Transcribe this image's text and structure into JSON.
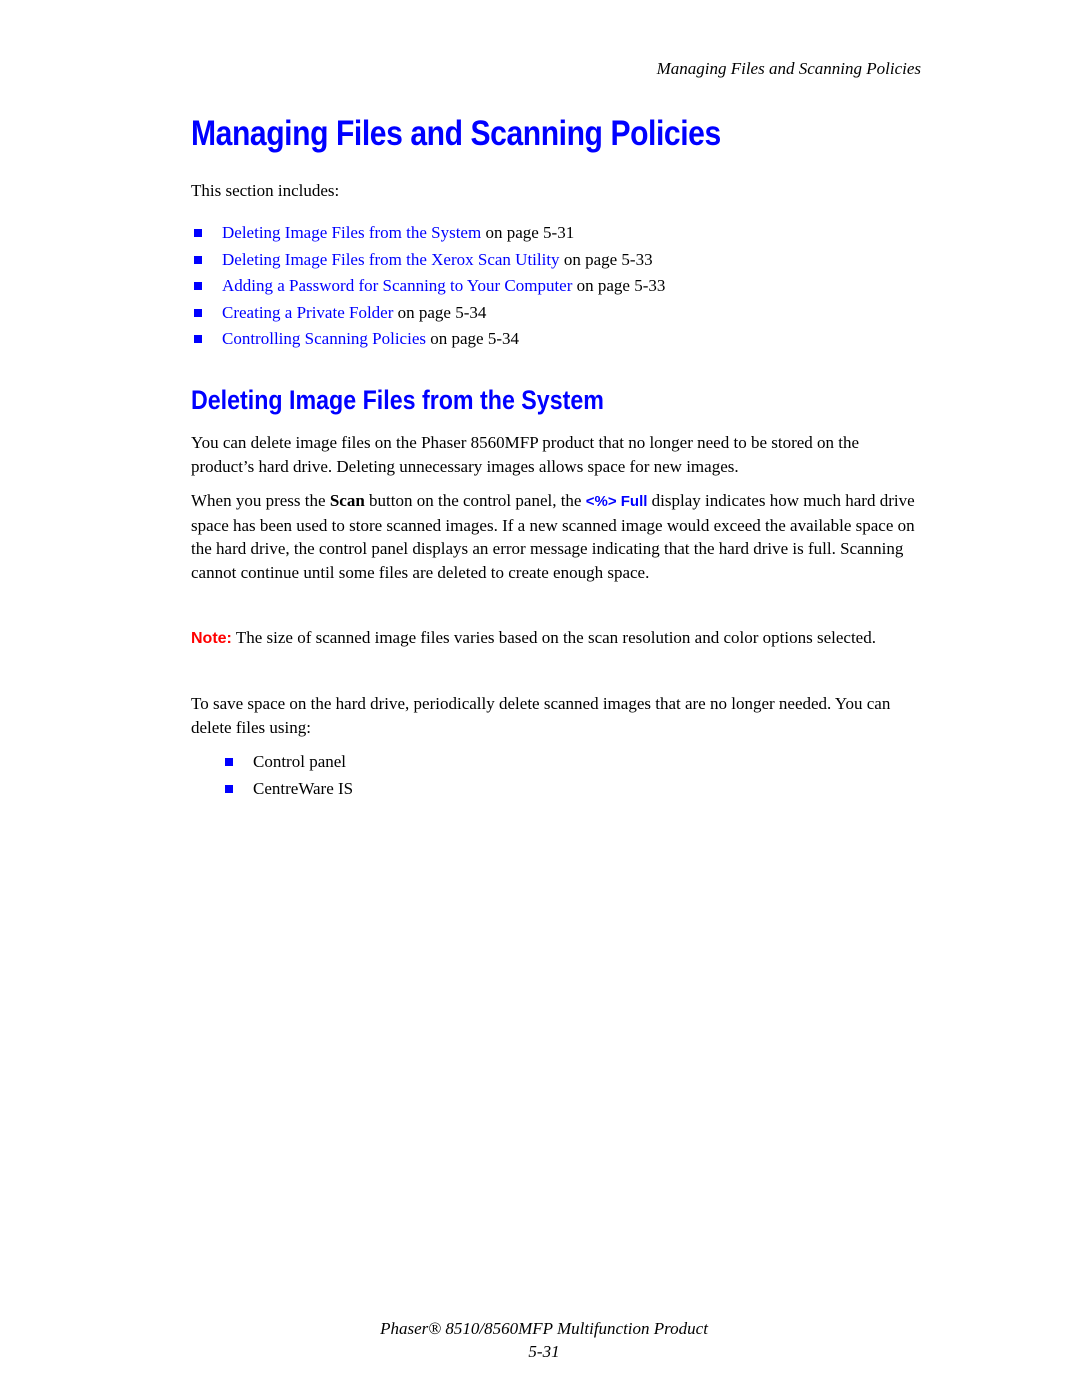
{
  "header": {
    "running_title": "Managing Files and Scanning Policies"
  },
  "title": "Managing Files and Scanning Policies",
  "intro": "This section includes:",
  "toc": [
    {
      "link": "Deleting Image Files from the System",
      "suffix": " on page 5-31"
    },
    {
      "link": "Deleting Image Files from the Xerox Scan Utility",
      "suffix": " on page 5-33"
    },
    {
      "link": "Adding a Password for Scanning to Your Computer",
      "suffix": " on page 5-33"
    },
    {
      "link": "Creating a Private Folder",
      "suffix": " on page 5-34"
    },
    {
      "link": "Controlling Scanning Policies",
      "suffix": " on page 5-34"
    }
  ],
  "section": {
    "heading": "Deleting Image Files from the System",
    "para1": "You can delete image files on the Phaser 8560MFP product that no longer need to be stored on the product’s hard drive. Deleting unnecessary images allows space for new images.",
    "para2": {
      "before": "When you press the ",
      "bold": "Scan",
      "middle": " button on the control panel, the ",
      "ui_text": "<%> Full",
      "after": " display indicates how much hard drive space has been used to store scanned images. If a new scanned image would exceed the available space on the hard drive, the control panel displays an error message indicating that the hard drive is full. Scanning cannot continue until some files are deleted to create enough space."
    },
    "note": {
      "label": "Note:",
      "text": " The size of scanned image files varies based on the scan resolution and color options selected."
    },
    "para3": "To save space on the hard drive, periodically delete scanned images that are no longer needed. You can delete files using:",
    "methods": [
      "Control panel",
      "CentreWare IS"
    ]
  },
  "footer": {
    "product": "Phaser® 8510/8560MFP Multifunction Product",
    "page": "5-31"
  },
  "colors": {
    "link": "#0000ff",
    "note": "#ff0000",
    "heading": "#0000ff"
  }
}
